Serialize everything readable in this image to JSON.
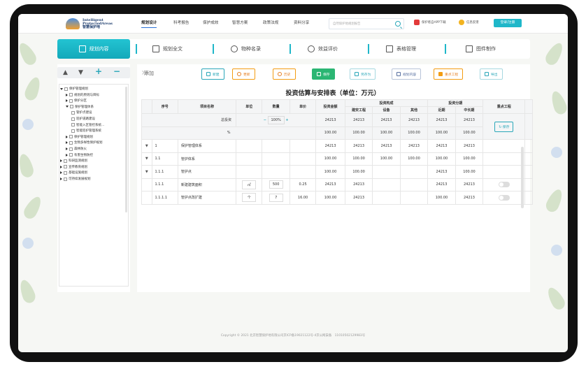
{
  "logo": {
    "line1": "Intelligent",
    "line2": "ProtectedAreas",
    "line3": "智慧保护地"
  },
  "nav": [
    "规划设计",
    "科考报告",
    "保护成效",
    "智慧方案",
    "政策法规",
    "资料分享"
  ],
  "search": {
    "placeholder": "自然保护地规划报告"
  },
  "app_download": "保护者自APP下载",
  "feedback": "信息反馈",
  "login": "登录/注册",
  "tabs": [
    "规划内容",
    "规划全文",
    "物种名录",
    "效益评价",
    "表格管理",
    "图件制作"
  ],
  "tree_controls": {
    "up": "▲",
    "down": "▼",
    "plus": "+",
    "minus": "−"
  },
  "tree": [
    "保护管理规划",
    "规划的原则与目标",
    "保护分区",
    "保护管理体系",
    "管护点建设",
    "巡护道路建设",
    "智能入区管控系统...",
    "智能巡护管理系统",
    "保护管理规划",
    "生物多样性保护规划",
    "森林防火",
    "有害生物防控",
    "科研监测规划",
    "宣传教育规划",
    "基础设施规划",
    "可持续发展规划"
  ],
  "toolbar": {
    "add": "添加",
    "new": "新建",
    "update": "更新",
    "history": "历史",
    "save": "保存",
    "save_as": "另存为",
    "plan_content": "规划内容",
    "key_project": "重点工程",
    "export": "导出"
  },
  "table": {
    "title": "投资估算与安排表（单位：万元）",
    "headers": {
      "no": "序号",
      "name": "项目名称",
      "unit": "单位",
      "qty": "数量",
      "price": "单价",
      "amount": "投资金额",
      "comp": "投资构成",
      "build": "建安工程",
      "equip": "设备",
      "other": "其他",
      "stage": "投资分期",
      "near": "近期",
      "mid": "中长期",
      "key": "重点工程"
    },
    "total": {
      "label": "总投资",
      "zoom": "100%",
      "amount": "24213",
      "build": "24213",
      "equip": "24213",
      "other": "24213",
      "near": "24213",
      "mid": "24213",
      "save": "保存"
    },
    "pct": {
      "label": "%",
      "amount": "100.00",
      "build": "100.00",
      "equip": "100.00",
      "other": "100.00",
      "near": "100.00",
      "mid": "100.00"
    },
    "rows": [
      {
        "no": "1",
        "name": "保护管理体系",
        "unit": "",
        "qty": "",
        "price": "",
        "amount": "24213",
        "build": "24213",
        "equip": "24213",
        "other": "24213",
        "near": "24213",
        "mid": "24213"
      },
      {
        "no": "1.1",
        "name": "管护体系",
        "unit": "",
        "qty": "",
        "price": "",
        "amount": "100.00",
        "build": "100.00",
        "equip": "100.00",
        "other": "100.00",
        "near": "100.00",
        "mid": "100.00"
      },
      {
        "no": "1.1.1",
        "name": "管护点",
        "unit": "",
        "qty": "",
        "price": "",
        "amount": "100.00",
        "build": "100.00",
        "equip": "",
        "other": "",
        "near": "24213",
        "mid": "100.00"
      },
      {
        "no": "1.1.1",
        "name": "新建建筑面积",
        "unit": "㎡",
        "qty": "500",
        "price": "0.25",
        "amount": "24213",
        "build": "24213",
        "equip": "",
        "other": "",
        "near": "24213",
        "mid": "24213"
      },
      {
        "no": "1.1.1.1",
        "name": "管护点改扩建",
        "unit": "个",
        "qty": "7",
        "price": "16.00",
        "amount": "100.00",
        "build": "24213",
        "equip": "",
        "other": "",
        "near": "100.00",
        "mid": "24213"
      }
    ]
  },
  "footer": "Copyright © 2021 北京智慧保护地有限公司京ICP备19021122号-4京公网安备　11010502129983号",
  "colors": {
    "accent": "#1fb7c9",
    "save_green": "#2bb673",
    "orange": "#f39c12",
    "red": "#e23a3a"
  }
}
